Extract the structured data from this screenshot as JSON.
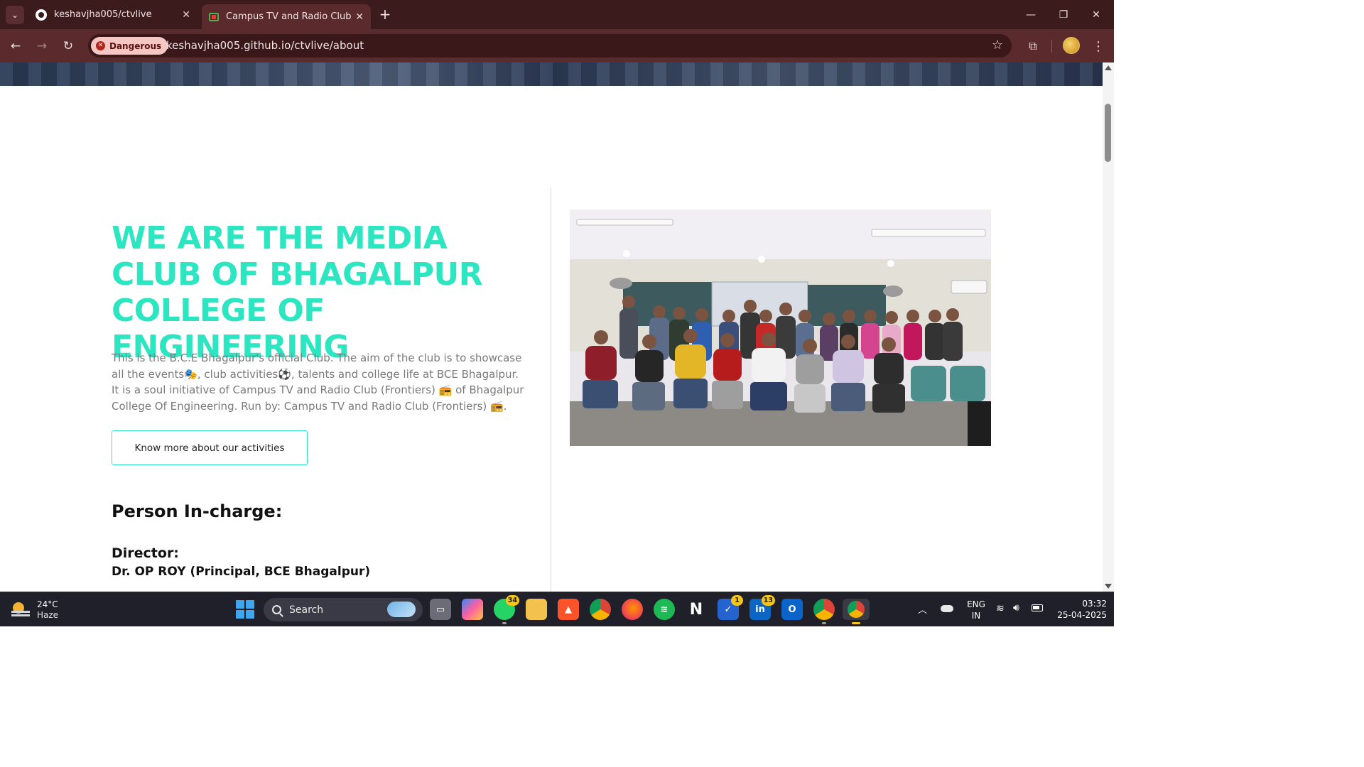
{
  "browser": {
    "tabs": [
      {
        "title": "keshavjha005/ctvlive",
        "icon": "github-icon",
        "active": false
      },
      {
        "title": "Campus TV and Radio Club",
        "icon": "tv-icon",
        "active": true
      }
    ],
    "tab_close_glyph": "✕",
    "new_tab_glyph": "+",
    "window": {
      "minimize": "—",
      "maximize": "❐",
      "close": "✕"
    },
    "security_chip": "Dangerous",
    "url": "keshavjha005.github.io/ctvlive/about",
    "accent_color": "#5b2a2c"
  },
  "page": {
    "headline": "WE ARE THE MEDIA CLUB OF BHAGALPUR COLLEGE OF ENGINEERING",
    "about": "This is the B.C.E Bhagalpur's official Club. The aim of the club is to showcase all the events🎭, club activities⚽, talents and college life at BCE Bhagalpur. It is a soul initiative of Campus TV and Radio Club (Frontiers) 📻 of Bhagalpur College Of Engineering. Run by: Campus TV and Radio Club (Frontiers) 📻.",
    "cta_label": "Know more about our activities",
    "incharge_heading": "Person In-charge:",
    "director_label": "Director:",
    "director_name": "Dr. OP ROY (Principal, BCE Bhagalpur)",
    "accent_color": "#2ce6c2"
  },
  "taskbar": {
    "weather": {
      "temp": "24°C",
      "condition": "Haze"
    },
    "search_placeholder": "Search",
    "apps": [
      {
        "name": "task-view",
        "badge": ""
      },
      {
        "name": "copilot",
        "badge": ""
      },
      {
        "name": "whatsapp",
        "badge": "34"
      },
      {
        "name": "file-explorer",
        "badge": ""
      },
      {
        "name": "brave",
        "badge": ""
      },
      {
        "name": "chrome",
        "badge": ""
      },
      {
        "name": "firefox",
        "badge": ""
      },
      {
        "name": "spotify",
        "badge": ""
      },
      {
        "name": "notion",
        "badge": ""
      },
      {
        "name": "todo",
        "badge": "1"
      },
      {
        "name": "linkedin",
        "badge": "13"
      },
      {
        "name": "outlook",
        "badge": ""
      },
      {
        "name": "chrome-profile",
        "badge": ""
      },
      {
        "name": "chrome-active",
        "badge": ""
      }
    ],
    "tray": {
      "lang_top": "ENG",
      "lang_bottom": "IN"
    },
    "clock": {
      "time": "03:32",
      "date": "25-04-2025"
    }
  }
}
